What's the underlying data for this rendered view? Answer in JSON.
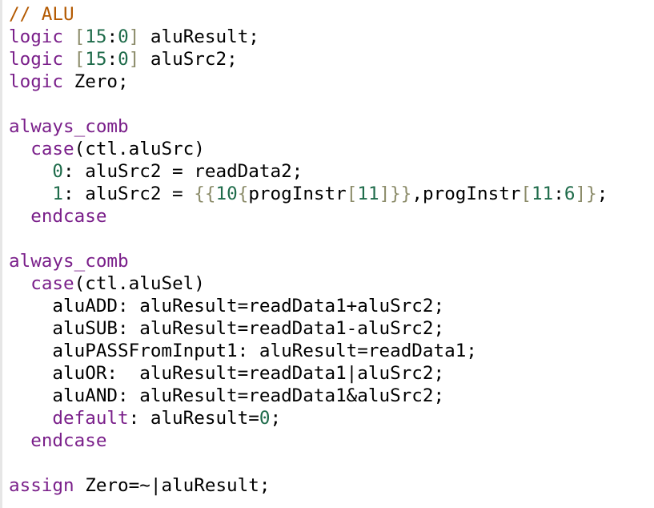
{
  "colors": {
    "comment": "#b35900",
    "keyword": "#7a1f8a",
    "number": "#1e6b4a",
    "bracket": "#8c8c6a",
    "text": "#000000",
    "background": "#ffffff",
    "gutter": "#e6e6e6"
  },
  "code": {
    "lines": [
      [
        {
          "c": "comment",
          "t": "// ALU"
        }
      ],
      [
        {
          "c": "kw",
          "t": "logic"
        },
        {
          "c": "plain",
          "t": " "
        },
        {
          "c": "br",
          "t": "["
        },
        {
          "c": "num",
          "t": "15"
        },
        {
          "c": "plain",
          "t": ":"
        },
        {
          "c": "num",
          "t": "0"
        },
        {
          "c": "br",
          "t": "]"
        },
        {
          "c": "plain",
          "t": " aluResult;"
        }
      ],
      [
        {
          "c": "kw",
          "t": "logic"
        },
        {
          "c": "plain",
          "t": " "
        },
        {
          "c": "br",
          "t": "["
        },
        {
          "c": "num",
          "t": "15"
        },
        {
          "c": "plain",
          "t": ":"
        },
        {
          "c": "num",
          "t": "0"
        },
        {
          "c": "br",
          "t": "]"
        },
        {
          "c": "plain",
          "t": " aluSrc2;"
        }
      ],
      [
        {
          "c": "kw",
          "t": "logic"
        },
        {
          "c": "plain",
          "t": " Zero;"
        }
      ],
      [],
      [
        {
          "c": "kw",
          "t": "always_comb"
        }
      ],
      [
        {
          "c": "plain",
          "t": "  "
        },
        {
          "c": "kw",
          "t": "case"
        },
        {
          "c": "plain",
          "t": "(ctl.aluSrc)"
        }
      ],
      [
        {
          "c": "plain",
          "t": "    "
        },
        {
          "c": "num",
          "t": "0"
        },
        {
          "c": "plain",
          "t": ": aluSrc2 = readData2;"
        }
      ],
      [
        {
          "c": "plain",
          "t": "    "
        },
        {
          "c": "num",
          "t": "1"
        },
        {
          "c": "plain",
          "t": ": aluSrc2 = "
        },
        {
          "c": "br",
          "t": "{{"
        },
        {
          "c": "num",
          "t": "10"
        },
        {
          "c": "br",
          "t": "{"
        },
        {
          "c": "plain",
          "t": "progInstr"
        },
        {
          "c": "br",
          "t": "["
        },
        {
          "c": "num",
          "t": "11"
        },
        {
          "c": "br",
          "t": "]}}"
        },
        {
          "c": "plain",
          "t": ",progInstr"
        },
        {
          "c": "br",
          "t": "["
        },
        {
          "c": "num",
          "t": "11"
        },
        {
          "c": "plain",
          "t": ":"
        },
        {
          "c": "num",
          "t": "6"
        },
        {
          "c": "br",
          "t": "]}"
        },
        {
          "c": "plain",
          "t": ";"
        }
      ],
      [
        {
          "c": "plain",
          "t": "  "
        },
        {
          "c": "kw",
          "t": "endcase"
        }
      ],
      [],
      [
        {
          "c": "kw",
          "t": "always_comb"
        }
      ],
      [
        {
          "c": "plain",
          "t": "  "
        },
        {
          "c": "kw",
          "t": "case"
        },
        {
          "c": "plain",
          "t": "(ctl.aluSel)"
        }
      ],
      [
        {
          "c": "plain",
          "t": "    aluADD: aluResult=readData1+aluSrc2;"
        }
      ],
      [
        {
          "c": "plain",
          "t": "    aluSUB: aluResult=readData1-aluSrc2;"
        }
      ],
      [
        {
          "c": "plain",
          "t": "    aluPASSFromInput1: aluResult=readData1;"
        }
      ],
      [
        {
          "c": "plain",
          "t": "    aluOR:  aluResult=readData1|aluSrc2;"
        }
      ],
      [
        {
          "c": "plain",
          "t": "    aluAND: aluResult=readData1&aluSrc2;"
        }
      ],
      [
        {
          "c": "plain",
          "t": "    "
        },
        {
          "c": "kw",
          "t": "default"
        },
        {
          "c": "plain",
          "t": ": aluResult="
        },
        {
          "c": "num",
          "t": "0"
        },
        {
          "c": "plain",
          "t": ";"
        }
      ],
      [
        {
          "c": "plain",
          "t": "  "
        },
        {
          "c": "kw",
          "t": "endcase"
        }
      ],
      [],
      [
        {
          "c": "kw",
          "t": "assign"
        },
        {
          "c": "plain",
          "t": " Zero=~|aluResult;"
        }
      ]
    ]
  }
}
